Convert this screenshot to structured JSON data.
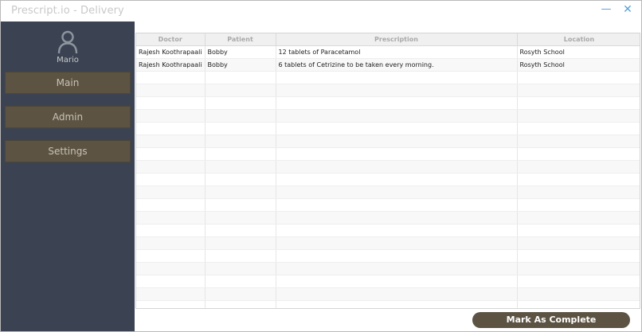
{
  "window": {
    "title": "Prescript.io - Delivery",
    "minimize_glyph": "—",
    "close_glyph": "✕"
  },
  "sidebar": {
    "user_icon": "user-icon",
    "user_name": "Mario",
    "items": [
      {
        "label": "Main"
      },
      {
        "label": "Admin"
      },
      {
        "label": "Settings"
      }
    ]
  },
  "grid": {
    "columns": [
      "Doctor",
      "Patient",
      "Prescription",
      "Location"
    ],
    "rows": [
      [
        "Rajesh Koothrapaali",
        "Bobby",
        "12 tablets of Paracetamol",
        "Rosyth School"
      ],
      [
        "Rajesh Koothrapaali",
        "Bobby",
        "6 tablets of Cetrizine to be taken every morning.",
        "Rosyth School"
      ]
    ]
  },
  "actions": {
    "mark_complete_label": "Mark As Complete"
  },
  "colors": {
    "sidebar_bg": "#3b4353",
    "button_bg": "#5c5342",
    "accent_blue": "#5aa0d8"
  }
}
